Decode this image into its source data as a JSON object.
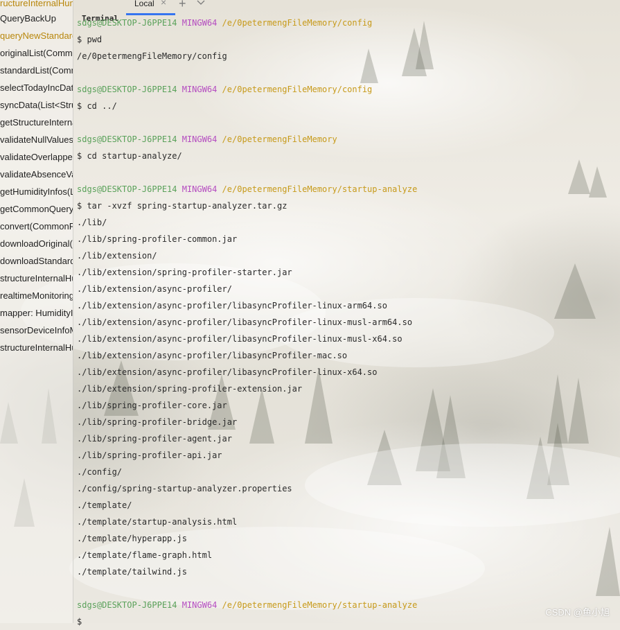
{
  "tabs": {
    "terminal_label": "Terminal",
    "local_label": "Local",
    "close_glyph": "×",
    "add_glyph": "+",
    "dropdown_icon": "chevron-down-icon"
  },
  "left_panel": {
    "items": [
      {
        "label": "ructureInternalHum",
        "highlight": true
      },
      {
        "label": "QueryBackUp",
        "highlight": false
      },
      {
        "label": "queryNewStandard",
        "highlight": true
      },
      {
        "label": "originalList(Comm",
        "highlight": false
      },
      {
        "label": "standardList(Comm",
        "highlight": false
      },
      {
        "label": "selectTodayIncData",
        "highlight": false
      },
      {
        "label": "syncData(List<Struc",
        "highlight": false
      },
      {
        "label": "getStructureInterna",
        "highlight": false
      },
      {
        "label": "validateNullValues(",
        "highlight": false
      },
      {
        "label": "validateOverlapped",
        "highlight": false
      },
      {
        "label": "validateAbsenceVa",
        "highlight": false
      },
      {
        "label": "getHumidityInfos(L",
        "highlight": false
      },
      {
        "label": "getCommonQuery",
        "highlight": false
      },
      {
        "label": "convert(CommonPa",
        "highlight": false
      },
      {
        "label": "downloadOriginal(",
        "highlight": false
      },
      {
        "label": "downloadStandard",
        "highlight": false
      },
      {
        "label": "structureInternalHu",
        "highlight": false
      },
      {
        "label": "realtimeMonitoring",
        "highlight": false
      },
      {
        "label": "mapper: HumidityI",
        "highlight": false
      },
      {
        "label": "sensorDeviceInfoM",
        "highlight": false
      },
      {
        "label": "structureInternalHu",
        "highlight": false
      }
    ]
  },
  "terminal": {
    "prompt_user": "sdgs@DESKTOP-J6PPE14",
    "prompt_shell": "MINGW64",
    "lines": [
      {
        "type": "prompt",
        "path": "/e/0petermengFileMemory/config"
      },
      {
        "type": "text",
        "text": "$ pwd"
      },
      {
        "type": "text",
        "text": "/e/0petermengFileMemory/config"
      },
      {
        "type": "text",
        "text": ""
      },
      {
        "type": "prompt",
        "path": "/e/0petermengFileMemory/config"
      },
      {
        "type": "text",
        "text": "$ cd ../"
      },
      {
        "type": "text",
        "text": ""
      },
      {
        "type": "prompt",
        "path": "/e/0petermengFileMemory"
      },
      {
        "type": "text",
        "text": "$ cd startup-analyze/"
      },
      {
        "type": "text",
        "text": ""
      },
      {
        "type": "prompt",
        "path": "/e/0petermengFileMemory/startup-analyze"
      },
      {
        "type": "text",
        "text": "$ tar -xvzf spring-startup-analyzer.tar.gz"
      },
      {
        "type": "text",
        "text": "./lib/"
      },
      {
        "type": "text",
        "text": "./lib/spring-profiler-common.jar"
      },
      {
        "type": "text",
        "text": "./lib/extension/"
      },
      {
        "type": "text",
        "text": "./lib/extension/spring-profiler-starter.jar"
      },
      {
        "type": "text",
        "text": "./lib/extension/async-profiler/"
      },
      {
        "type": "text",
        "text": "./lib/extension/async-profiler/libasyncProfiler-linux-arm64.so"
      },
      {
        "type": "text",
        "text": "./lib/extension/async-profiler/libasyncProfiler-linux-musl-arm64.so"
      },
      {
        "type": "text",
        "text": "./lib/extension/async-profiler/libasyncProfiler-linux-musl-x64.so"
      },
      {
        "type": "text",
        "text": "./lib/extension/async-profiler/libasyncProfiler-mac.so"
      },
      {
        "type": "text",
        "text": "./lib/extension/async-profiler/libasyncProfiler-linux-x64.so"
      },
      {
        "type": "text",
        "text": "./lib/extension/spring-profiler-extension.jar"
      },
      {
        "type": "text",
        "text": "./lib/spring-profiler-core.jar"
      },
      {
        "type": "text",
        "text": "./lib/spring-profiler-bridge.jar"
      },
      {
        "type": "text",
        "text": "./lib/spring-profiler-agent.jar"
      },
      {
        "type": "text",
        "text": "./lib/spring-profiler-api.jar"
      },
      {
        "type": "text",
        "text": "./config/"
      },
      {
        "type": "text",
        "text": "./config/spring-startup-analyzer.properties"
      },
      {
        "type": "text",
        "text": "./template/"
      },
      {
        "type": "text",
        "text": "./template/startup-analysis.html"
      },
      {
        "type": "text",
        "text": "./template/hyperapp.js"
      },
      {
        "type": "text",
        "text": "./template/flame-graph.html"
      },
      {
        "type": "text",
        "text": "./template/tailwind.js"
      },
      {
        "type": "text",
        "text": ""
      },
      {
        "type": "prompt",
        "path": "/e/0petermengFileMemory/startup-analyze"
      },
      {
        "type": "text",
        "text": "$"
      }
    ]
  },
  "watermark": "CSDN @鱼小旭",
  "colors": {
    "user": "#5aa15a",
    "shell": "#b44cc0",
    "path": "#c79a1a",
    "tab_accent": "#3574f0",
    "left_highlight": "#b8860b"
  }
}
